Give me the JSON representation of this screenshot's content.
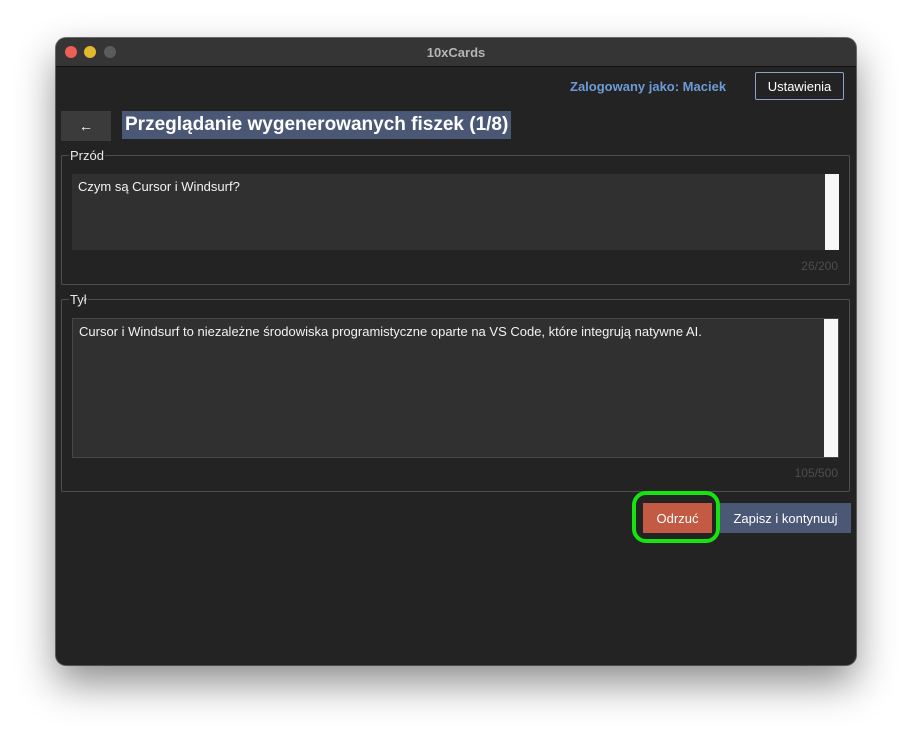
{
  "window": {
    "title": "10xCards"
  },
  "header": {
    "logged_in_label": "Zalogowany jako: Maciek",
    "settings_label": "Ustawienia"
  },
  "nav": {
    "back_icon": "arrow-left-icon",
    "back_glyph": "←",
    "page_title": "Przeglądanie wygenerowanych fiszek (1/8)"
  },
  "front": {
    "legend": "Przód",
    "value": "Czym są Cursor i Windsurf?",
    "counter": "26/200"
  },
  "back": {
    "legend": "Tył",
    "value": "Cursor i Windsurf to niezależne środowiska programistyczne oparte na VS Code, które integrują natywne AI.",
    "counter": "105/500"
  },
  "actions": {
    "reject_label": "Odrzuć",
    "save_label": "Zapisz i kontynuuj"
  },
  "colors": {
    "accent": "#4a5876",
    "reject": "#c35a43",
    "highlight": "#17e30f",
    "link": "#6d9bd8"
  }
}
